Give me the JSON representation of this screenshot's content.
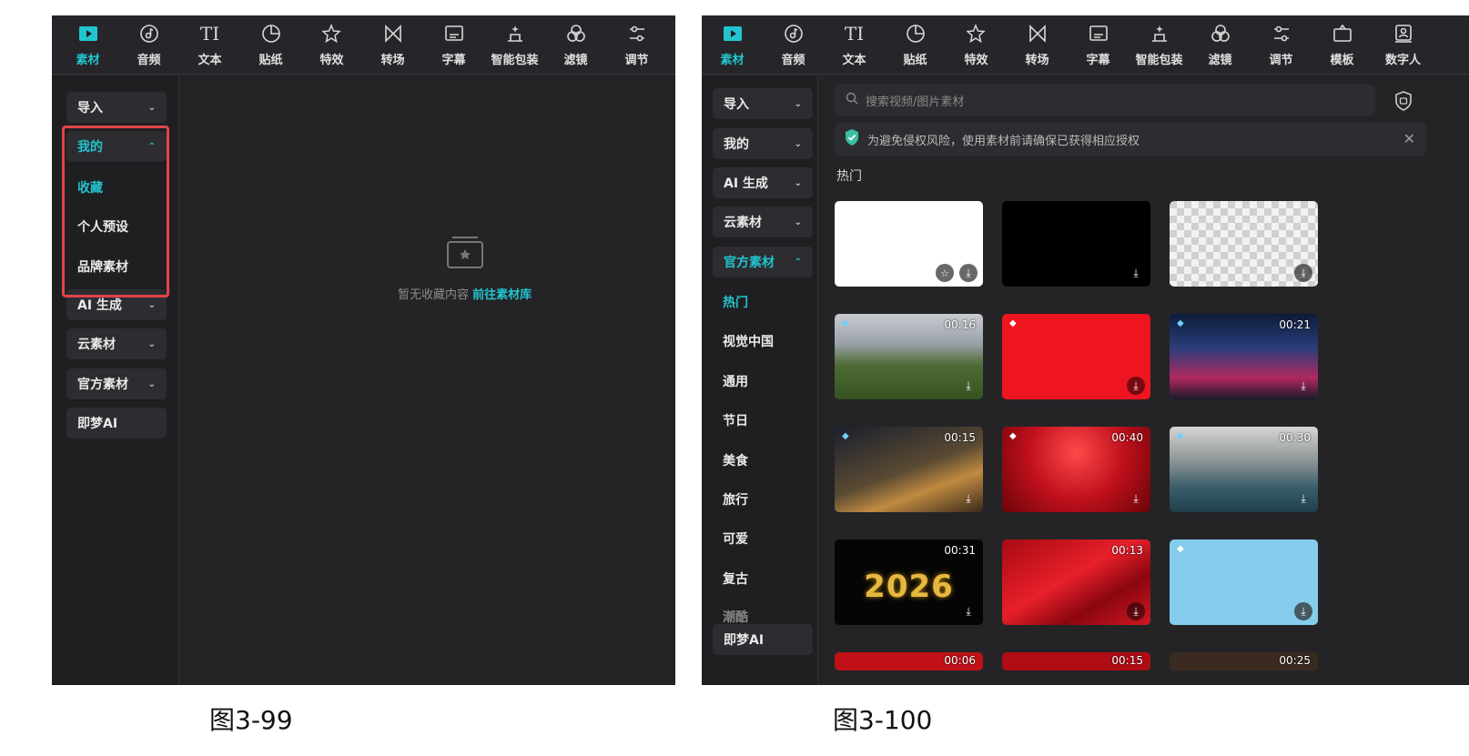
{
  "toolbar": {
    "tabs": [
      {
        "label": "素材",
        "icon": "play-square-icon",
        "active": true
      },
      {
        "label": "音频",
        "icon": "music-disc-icon"
      },
      {
        "label": "文本",
        "icon": "text-ti-icon"
      },
      {
        "label": "贴纸",
        "icon": "sticker-icon"
      },
      {
        "label": "特效",
        "icon": "star-effect-icon"
      },
      {
        "label": "转场",
        "icon": "transition-icon"
      },
      {
        "label": "字幕",
        "icon": "subtitle-icon"
      },
      {
        "label": "智能包装",
        "icon": "smart-pack-icon"
      },
      {
        "label": "滤镜",
        "icon": "filter-icon"
      },
      {
        "label": "调节",
        "icon": "adjust-icon"
      },
      {
        "label": "模板",
        "icon": "template-icon"
      },
      {
        "label": "数字人",
        "icon": "digital-human-icon"
      }
    ]
  },
  "left_panel": {
    "sidebar": {
      "import": "导入",
      "mine": "我的",
      "mine_items": [
        "收藏",
        "个人预设",
        "品牌素材"
      ],
      "ai": "AI 生成",
      "cloud": "云素材",
      "official": "官方素材",
      "jimeng": "即梦AI"
    },
    "empty_text": "暂无收藏内容",
    "empty_link": "前往素材库",
    "caption": "图3-99"
  },
  "right_panel": {
    "sidebar": {
      "import": "导入",
      "mine": "我的",
      "ai": "AI 生成",
      "cloud": "云素材",
      "official": "官方素材",
      "official_items": [
        "热门",
        "视觉中国",
        "通用",
        "节日",
        "美食",
        "旅行",
        "可爱",
        "复古",
        "潮酷"
      ],
      "jimeng": "即梦AI"
    },
    "search_placeholder": "搜索视频/图片素材",
    "notice": "为避免侵权风险，使用素材前请确保已获得相应授权",
    "section_title": "热门",
    "cards": [
      {
        "duration": ""
      },
      {
        "duration": ""
      },
      {
        "duration": ""
      },
      {
        "duration": "00:16"
      },
      {
        "duration": ""
      },
      {
        "duration": "00:21"
      },
      {
        "duration": "00:15"
      },
      {
        "duration": "00:40"
      },
      {
        "duration": "00:30"
      },
      {
        "duration": "00:31",
        "text": "2026"
      },
      {
        "duration": "00:13"
      },
      {
        "duration": ""
      },
      {
        "duration": "00:06"
      },
      {
        "duration": "00:15"
      },
      {
        "duration": "00:25"
      }
    ],
    "caption": "图3-100"
  },
  "colors": {
    "accent": "#22c4cf",
    "panel": "#242427",
    "highlight_box": "#e0444a"
  }
}
